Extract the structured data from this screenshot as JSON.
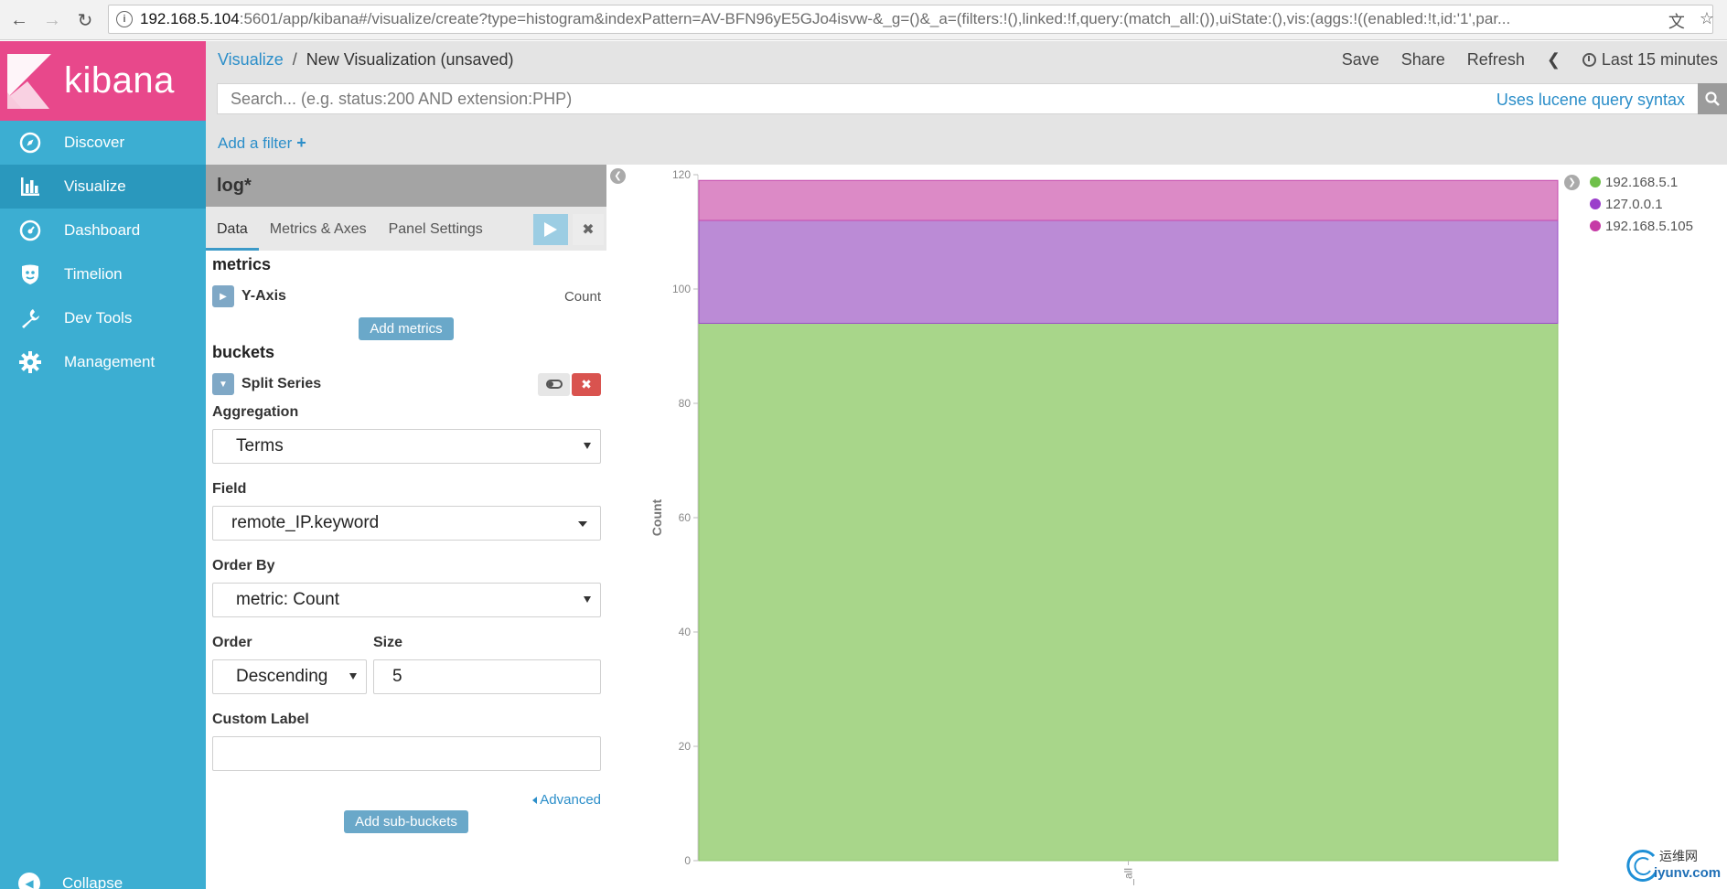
{
  "browser": {
    "url_host": "192.168.5.104",
    "url_rest": ":5601/app/kibana#/visualize/create?type=histogram&indexPattern=AV-BFN96yE5GJo4isvw-&_g=()&_a=(filters:!(),linked:!f,query:(match_all:()),uiState:(),vis:(aggs:!((enabled:!t,id:'1',par..."
  },
  "brand": {
    "name": "kibana"
  },
  "sidebar": {
    "items": [
      {
        "label": "Discover",
        "icon": "compass-icon"
      },
      {
        "label": "Visualize",
        "icon": "bar-chart-icon"
      },
      {
        "label": "Dashboard",
        "icon": "dashboard-icon"
      },
      {
        "label": "Timelion",
        "icon": "shield-icon"
      },
      {
        "label": "Dev Tools",
        "icon": "wrench-icon"
      },
      {
        "label": "Management",
        "icon": "gear-icon"
      }
    ],
    "collapse_label": "Collapse"
  },
  "header": {
    "breadcrumb_link": "Visualize",
    "breadcrumb_sep": "/",
    "breadcrumb_current": "New Visualization (unsaved)",
    "save": "Save",
    "share": "Share",
    "refresh": "Refresh",
    "time_range": "Last 15 minutes"
  },
  "search": {
    "placeholder": "Search... (e.g. status:200 AND extension:PHP)",
    "hint": "Uses lucene query syntax"
  },
  "filters": {
    "add_label": "Add a filter",
    "add_symbol": "+"
  },
  "editor": {
    "index_pattern": "log*",
    "tabs": [
      "Data",
      "Metrics & Axes",
      "Panel Settings"
    ],
    "metrics_title": "metrics",
    "metric_agg": {
      "label": "Y-Axis",
      "value": "Count"
    },
    "add_metrics": "Add metrics",
    "buckets_title": "buckets",
    "bucket_agg": {
      "label": "Split Series"
    },
    "aggregation": {
      "label": "Aggregation",
      "value": "Terms"
    },
    "field": {
      "label": "Field",
      "value": "remote_IP.keyword"
    },
    "order_by": {
      "label": "Order By",
      "value": "metric: Count"
    },
    "order": {
      "label": "Order",
      "value": "Descending"
    },
    "size": {
      "label": "Size",
      "value": "5"
    },
    "custom_label": {
      "label": "Custom Label",
      "value": ""
    },
    "advanced": "Advanced",
    "add_sub_buckets": "Add sub-buckets"
  },
  "chart_data": {
    "type": "bar",
    "stacked": true,
    "categories": [
      "_all"
    ],
    "series": [
      {
        "name": "192.168.5.1",
        "values": [
          94
        ],
        "color": "#a8d68a",
        "stroke": "#8fc46d"
      },
      {
        "name": "127.0.0.1",
        "values": [
          18
        ],
        "color": "#bb8bd6",
        "stroke": "#9b4fc8"
      },
      {
        "name": "192.168.5.105",
        "values": [
          7
        ],
        "color": "#dc8ac6",
        "stroke": "#c44aae"
      }
    ],
    "legend_colors": [
      "#6fc04a",
      "#9b3fcb",
      "#c63aa6"
    ],
    "ylabel": "Count",
    "ylim": [
      0,
      120
    ],
    "yticks": [
      0,
      20,
      40,
      60,
      80,
      100,
      120
    ],
    "legend_position": "right"
  },
  "watermark": {
    "cn": "运维网",
    "en": "iyunv.com"
  }
}
